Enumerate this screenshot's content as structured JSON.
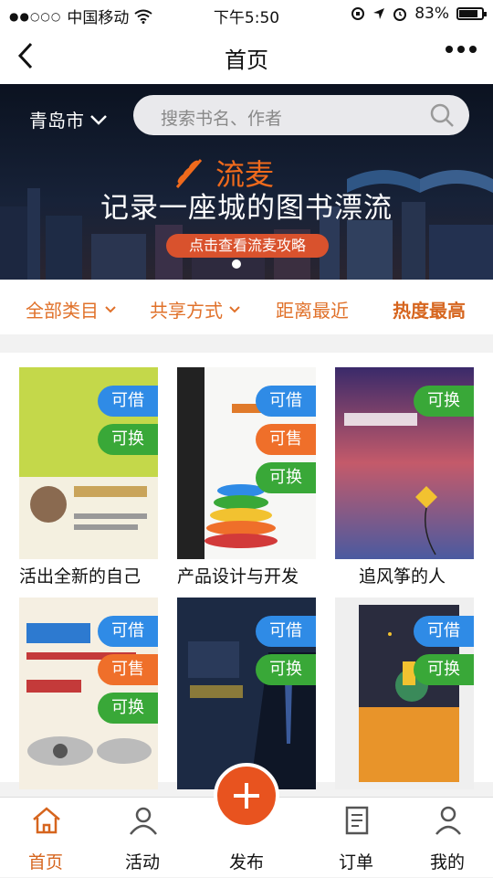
{
  "status": {
    "carrier": "中国移动",
    "time": "下午5:50",
    "battery": "83%",
    "battery_level": 0.83
  },
  "nav": {
    "title": "首页"
  },
  "banner": {
    "city": "青岛市",
    "search_placeholder": "搜索书名、作者",
    "brand": "流麦",
    "slogan": "记录一座城的图书漂流",
    "guide_button": "点击查看流麦攻略"
  },
  "filters": [
    "全部类目",
    "共享方式",
    "距离最近",
    "热度最高"
  ],
  "books": [
    {
      "title": "活出全新的自己",
      "tags": [
        "可借",
        "可换"
      ]
    },
    {
      "title": "产品设计与开发",
      "tags": [
        "可借",
        "可售",
        "可换"
      ]
    },
    {
      "title": "追风筝的人",
      "tags": [
        "可换"
      ]
    },
    {
      "title": "",
      "tags": [
        "可借",
        "可售",
        "可换"
      ]
    },
    {
      "title": "",
      "tags": [
        "可借",
        "可换"
      ]
    },
    {
      "title": "",
      "tags": [
        "可借",
        "可换"
      ]
    }
  ],
  "tabs": [
    "首页",
    "活动",
    "发布",
    "订单",
    "我的"
  ],
  "colors": {
    "accent": "#e8531f",
    "tag_borrow": "#2f8be6",
    "tag_swap": "#39a838",
    "tag_sell": "#ef6f2a"
  },
  "icons": [
    "signal-icon",
    "wifi-icon",
    "back-icon",
    "more-icon",
    "chevron-down-icon",
    "search-icon",
    "wheat-icon",
    "home-icon",
    "activity-icon",
    "plus-icon",
    "order-icon",
    "user-icon"
  ]
}
